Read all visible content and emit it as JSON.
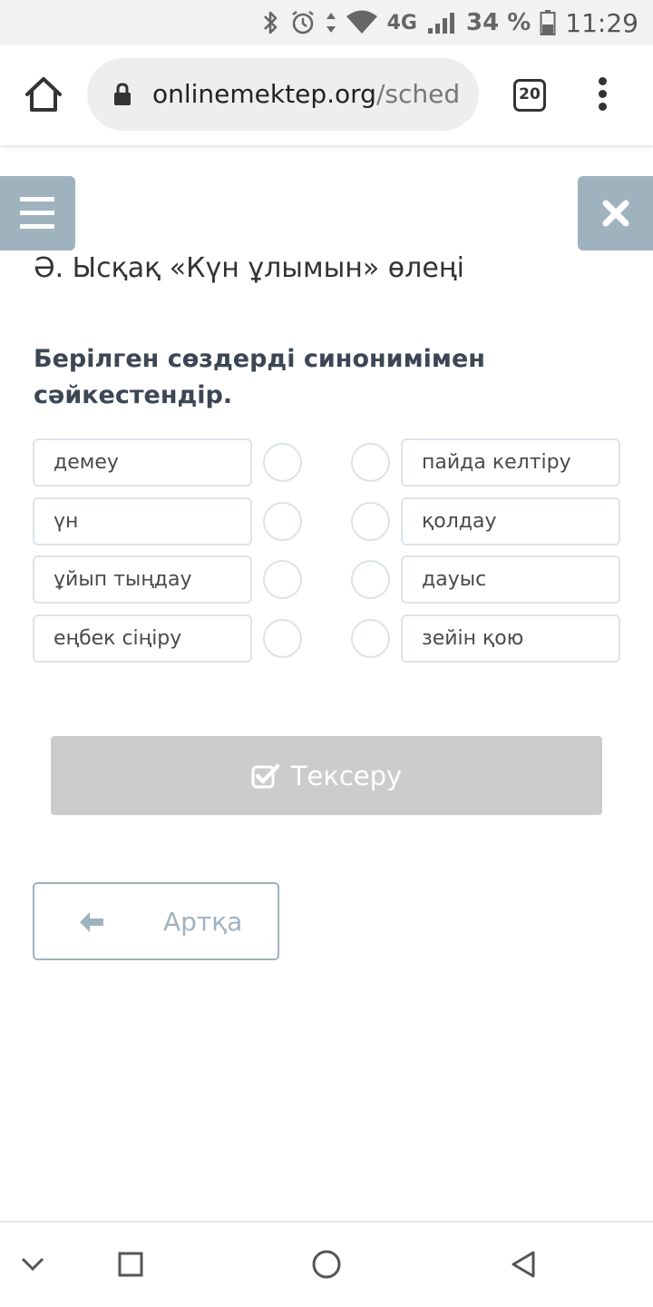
{
  "status_bar": {
    "network": "4G",
    "battery": "34 %",
    "time": "11:29"
  },
  "browser": {
    "url_domain": "onlinemektep.org",
    "url_path": "/schedule",
    "tab_count": "20"
  },
  "lesson": {
    "title": "Ә. Ысқақ «Күн ұлымын» өлеңі",
    "task": "Берілген сөздерді синонимімен сәйкестендір."
  },
  "matching": {
    "left": [
      "демеу",
      "үн",
      "ұйып тыңдау",
      "еңбек сіңіру"
    ],
    "right": [
      "пайда келтіру",
      "қолдау",
      "дауыс",
      "зейін қою"
    ]
  },
  "buttons": {
    "check_label": "Тексеру",
    "back_label": "Артқа"
  },
  "colors": {
    "accent": "#9fb3bf",
    "check_button": "#cccccc",
    "border": "#dde3e8"
  },
  "icons": {
    "menu": "hamburger-icon",
    "close": "close-icon",
    "check": "checkbox-check-icon",
    "back": "arrow-left-icon"
  }
}
